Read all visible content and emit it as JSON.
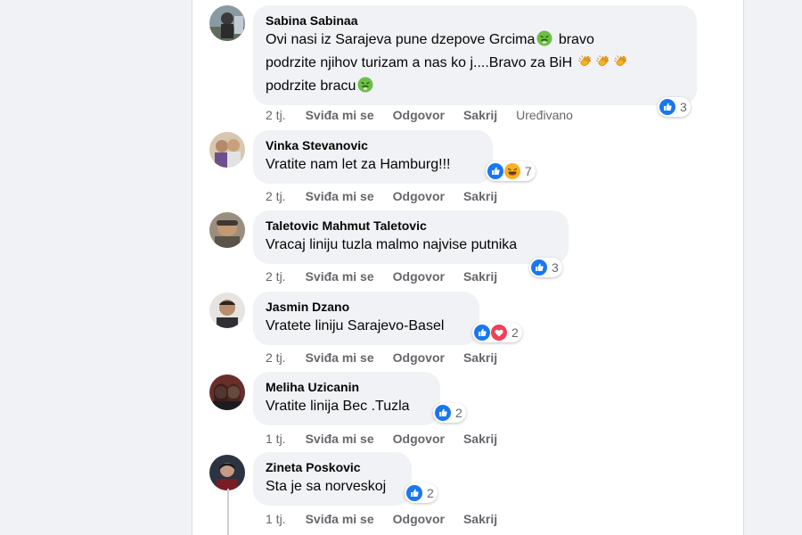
{
  "comments": [
    {
      "author": "Sabina Sabinaa",
      "lines": [
        "Ovi nasi iz Sarajeva pune dzepove Grcima",
        " bravo",
        "podrzite njihov turizam a nas ko j....Bravo za BiH ",
        "podrzite bracu"
      ],
      "reactions": [
        "like"
      ],
      "reaction_count": "3",
      "time": "2 tj.",
      "like_label": "Sviđa mi se",
      "reply_label": "Odgovor",
      "hide_label": "Sakrij",
      "edited_label": "Uređivano"
    },
    {
      "author": "Vinka Stevanovic",
      "text": "Vratite nam let za Hamburg!!!",
      "reactions": [
        "like",
        "haha"
      ],
      "reaction_count": "7",
      "time": "2 tj.",
      "like_label": "Sviđa mi se",
      "reply_label": "Odgovor",
      "hide_label": "Sakrij"
    },
    {
      "author": "Taletovic Mahmut Taletovic",
      "text": "Vracaj liniju tuzla malmo najvise putnika",
      "reactions": [
        "like"
      ],
      "reaction_count": "3",
      "time": "2 tj.",
      "like_label": "Sviđa mi se",
      "reply_label": "Odgovor",
      "hide_label": "Sakrij"
    },
    {
      "author": "Jasmin Dzano",
      "text": "Vratete liniju Sarajevo-Basel",
      "reactions": [
        "like",
        "love"
      ],
      "reaction_count": "2",
      "time": "2 tj.",
      "like_label": "Sviđa mi se",
      "reply_label": "Odgovor",
      "hide_label": "Sakrij"
    },
    {
      "author": "Meliha Uzicanin",
      "text": "Vratite linija Bec .Tuzla",
      "reactions": [
        "like"
      ],
      "reaction_count": "2",
      "time": "1 tj.",
      "like_label": "Sviđa mi se",
      "reply_label": "Odgovor",
      "hide_label": "Sakrij"
    },
    {
      "author": "Zineta Poskovic",
      "text": "Sta je sa norveskoj",
      "reactions": [
        "like"
      ],
      "reaction_count": "2",
      "time": "1 tj.",
      "like_label": "Sviđa mi se",
      "reply_label": "Odgovor",
      "hide_label": "Sakrij"
    }
  ],
  "colors": {
    "bubble": "#f0f2f5",
    "like_blue": "#1877f2",
    "love_red": "#f33e58",
    "haha_yellow": "#f7b125",
    "meta_gray": "#65676b"
  }
}
